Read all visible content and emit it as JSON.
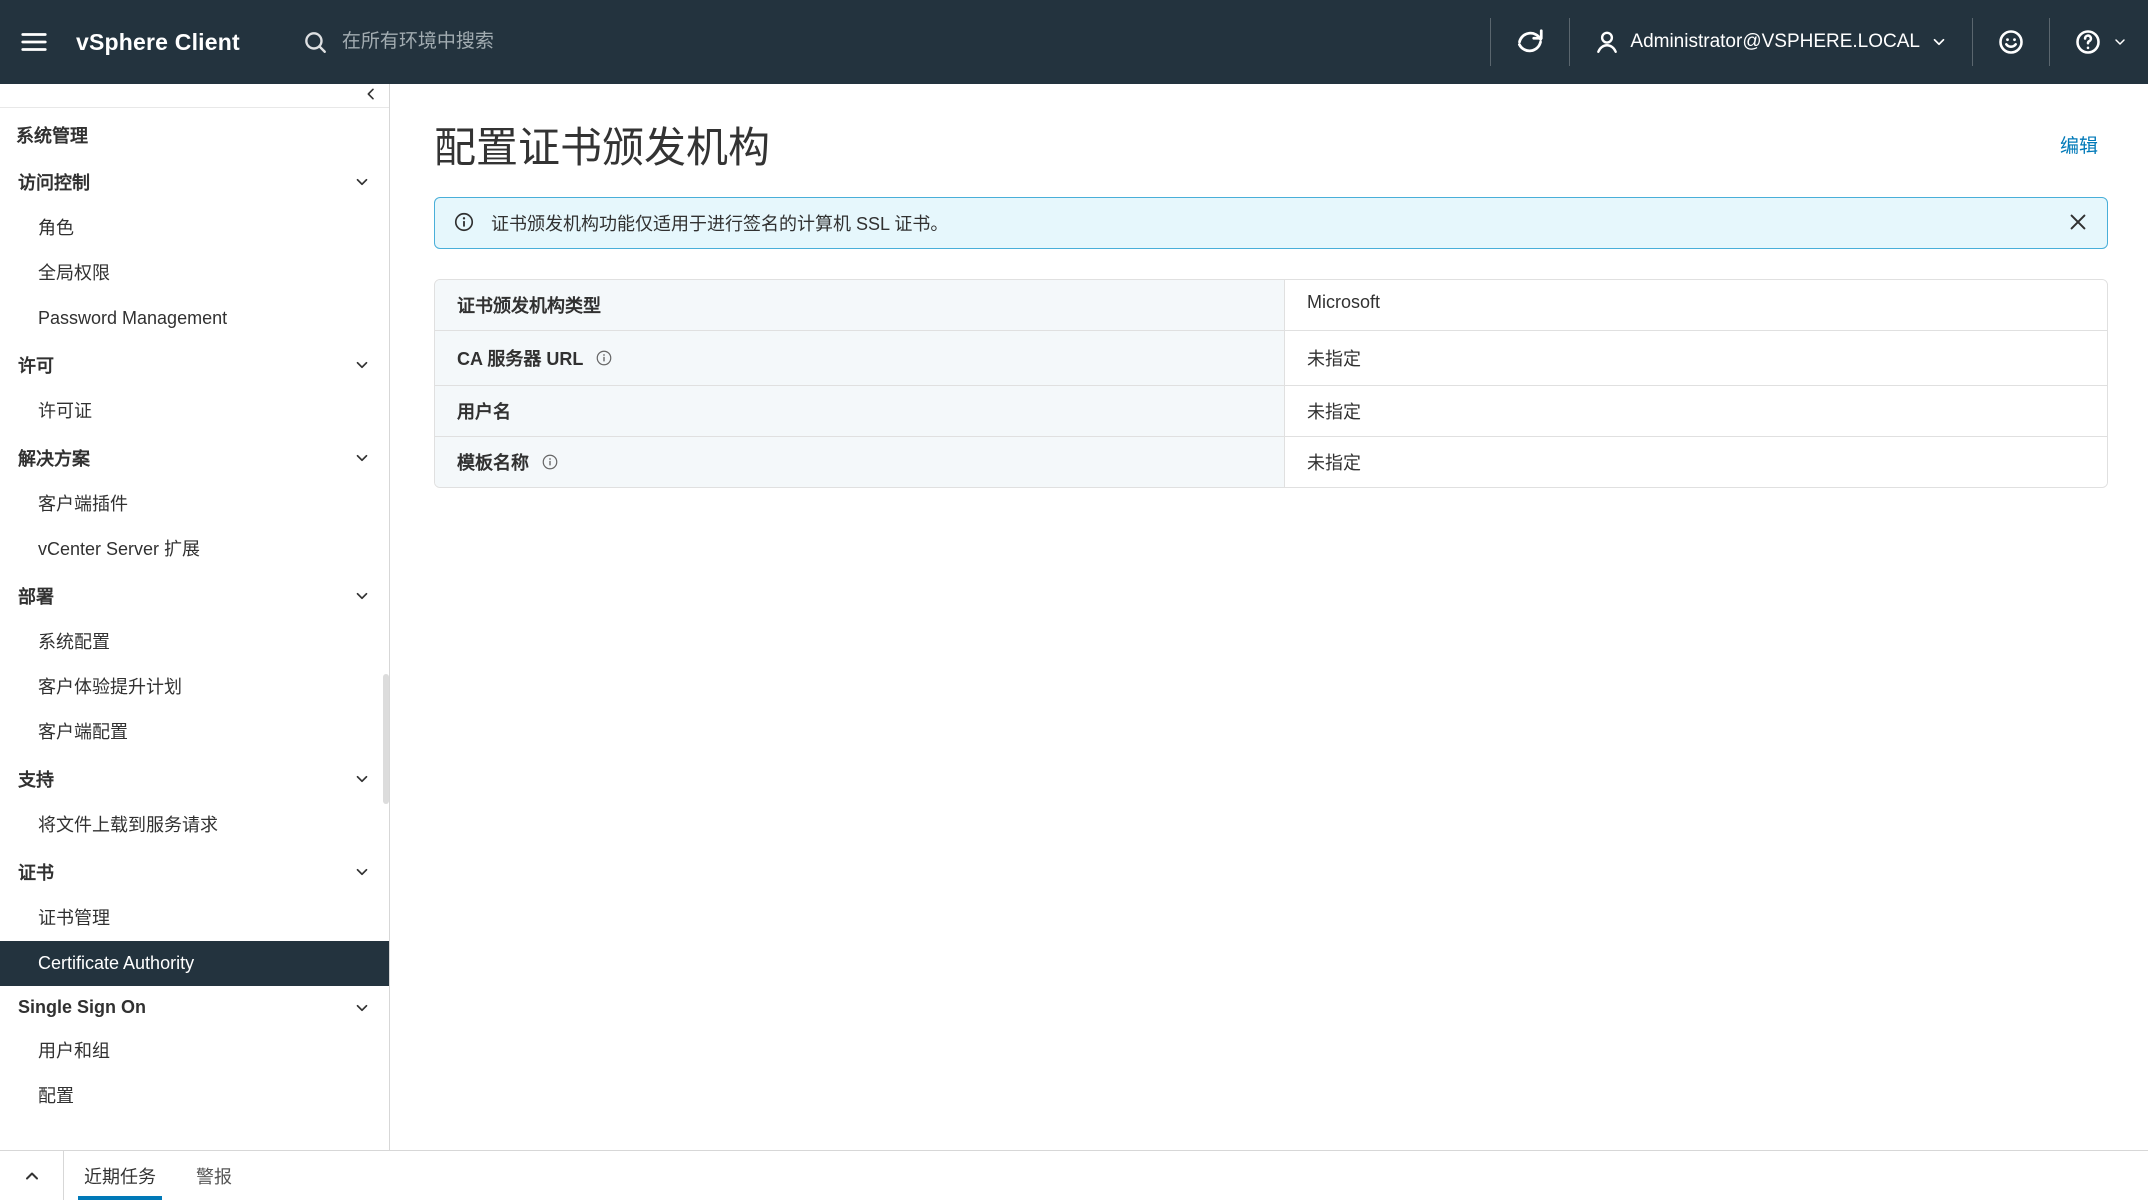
{
  "header": {
    "brand": "vSphere Client",
    "search_placeholder": "在所有环境中搜索",
    "user": "Administrator@VSPHERE.LOCAL"
  },
  "sidebar": {
    "title": "系统管理",
    "sections": [
      {
        "heading": "访问控制",
        "items": [
          "角色",
          "全局权限",
          "Password Management"
        ]
      },
      {
        "heading": "许可",
        "items": [
          "许可证"
        ]
      },
      {
        "heading": "解决方案",
        "items": [
          "客户端插件",
          "vCenter Server 扩展"
        ]
      },
      {
        "heading": "部署",
        "items": [
          "系统配置",
          "客户体验提升计划",
          "客户端配置"
        ]
      },
      {
        "heading": "支持",
        "items": [
          "将文件上载到服务请求"
        ]
      },
      {
        "heading": "证书",
        "items": [
          "证书管理",
          "Certificate Authority"
        ],
        "active_item": 1
      },
      {
        "heading": "Single Sign On",
        "items": [
          "用户和组",
          "配置"
        ]
      }
    ]
  },
  "main": {
    "title": "配置证书颁发机构",
    "edit_label": "编辑",
    "banner": "证书颁发机构功能仅适用于进行签名的计算机 SSL 证书。",
    "rows": [
      {
        "label": "证书颁发机构类型",
        "value": "Microsoft",
        "has_info_icon": false
      },
      {
        "label": "CA 服务器 URL",
        "value": "未指定",
        "has_info_icon": true
      },
      {
        "label": "用户名",
        "value": "未指定",
        "has_info_icon": false
      },
      {
        "label": "模板名称",
        "value": "未指定",
        "has_info_icon": true
      }
    ]
  },
  "bottombar": {
    "tabs": [
      "近期任务",
      "警报"
    ],
    "active_tab": 0
  }
}
